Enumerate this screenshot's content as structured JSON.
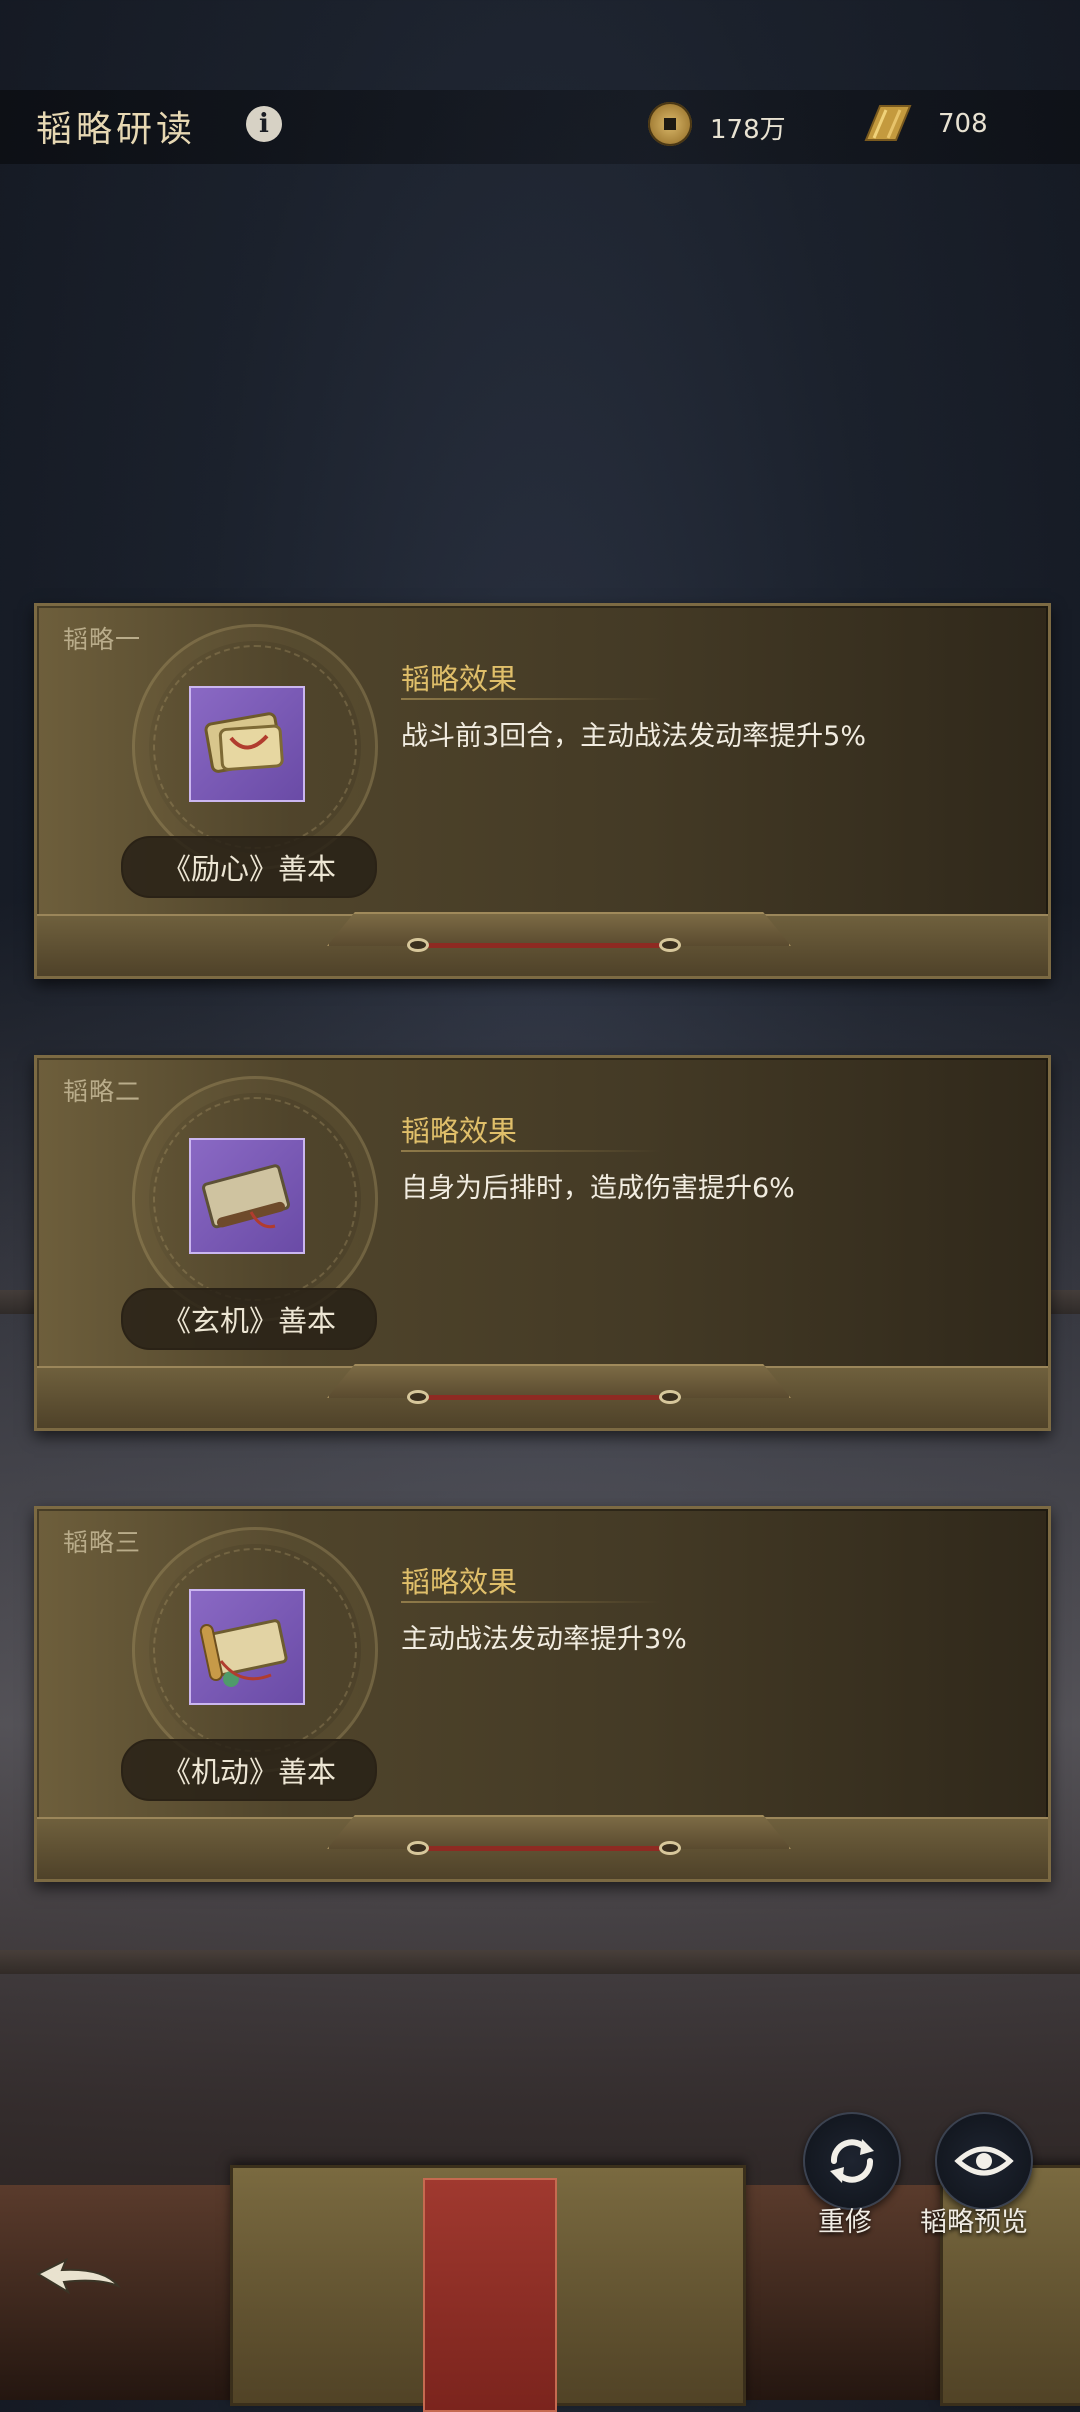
{
  "header": {
    "title": "韬略研读",
    "info_icon": "info-icon",
    "coins": {
      "icon": "coin-icon",
      "value": "178万"
    },
    "scrolls": {
      "icon": "scroll-icon",
      "value": "708"
    }
  },
  "cards": [
    {
      "tag": "韬略一",
      "name": "《励心》善本",
      "effect_title": "韬略效果",
      "effect_text": "战斗前3回合，主动战法发动率提升5%"
    },
    {
      "tag": "韬略二",
      "name": "《玄机》善本",
      "effect_title": "韬略效果",
      "effect_text": "自身为后排时，造成伤害提升6%"
    },
    {
      "tag": "韬略三",
      "name": "《机动》善本",
      "effect_title": "韬略效果",
      "effect_text": "主动战法发动率提升3%"
    }
  ],
  "actions": {
    "retrain_label": "重修",
    "preview_label": "韬略预览"
  },
  "colors": {
    "accent_gold": "#e0bf6a",
    "item_purple": "#7a59b5",
    "bar_red": "#8e2a22"
  }
}
